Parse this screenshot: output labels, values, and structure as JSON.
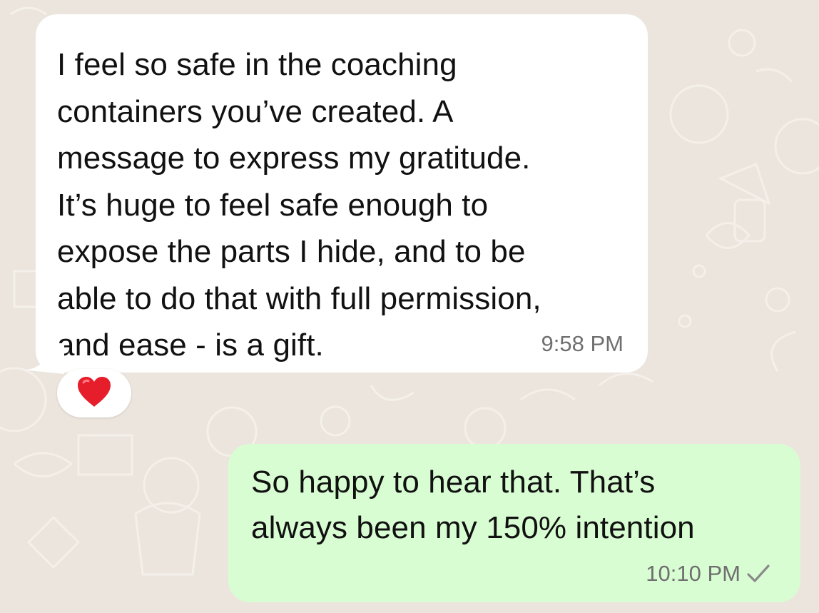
{
  "conversation": {
    "incoming": {
      "text": "I feel so safe in the coaching\ncontainers you’ve created. A\nmessage to express my gratitude.\nIt’s huge to feel safe enough to\nexpose the parts I hide, and to be\nable to do that with full permission,\nand ease - is a gift.",
      "time": "9:58 PM",
      "reaction": "heart-emoji"
    },
    "outgoing": {
      "text": "So happy to hear that. That’s\nalways been my 150% intention",
      "time": "10:10 PM",
      "status_icon": "single-check-icon"
    }
  },
  "colors": {
    "wallpaper": "#ece5dd",
    "incoming_bubble": "#ffffff",
    "outgoing_bubble": "#d9fdd3",
    "timestamp": "#6f6f6f",
    "check": "#8a8a8a",
    "heart": "#e61e2b"
  }
}
